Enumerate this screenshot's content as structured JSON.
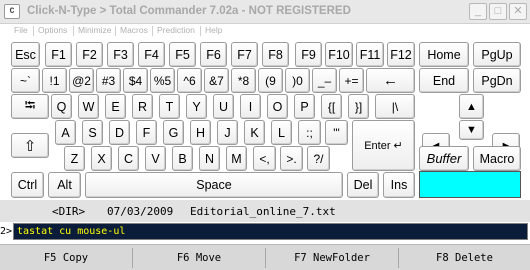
{
  "window": {
    "title": "Click-N-Type > Total Commander 7.02a - NOT REGISTERED",
    "icon_text": "C",
    "minimize_glyph": "_",
    "maximize_glyph": "□",
    "close_glyph": "✕"
  },
  "menu": [
    "File",
    "Options",
    "Minimize",
    "Macros",
    "Prediction",
    "Help"
  ],
  "keyboard": {
    "keys": {
      "esc": "Esc",
      "f1": "F1",
      "f2": "F2",
      "f3": "F3",
      "f4": "F4",
      "f5": "F5",
      "f6": "F6",
      "f7": "F7",
      "f8": "F8",
      "f9": "F9",
      "f10": "F10",
      "f11": "F11",
      "f12": "F12",
      "home": "Home",
      "pgup": "PgUp",
      "tilde": "~`",
      "k1": "!1",
      "k2": "@2",
      "k3": "#3",
      "k4": "$4",
      "k5": "%5",
      "k6": "^6",
      "k7": "&7",
      "k8": "*8",
      "k9": "(9",
      "k0": ")0",
      "minus": "_–",
      "plus": "+=",
      "backspace": "←",
      "end": "End",
      "pgdn": "PgDn",
      "tab": "⭾",
      "q": "Q",
      "w": "W",
      "e": "E",
      "r": "R",
      "t": "T",
      "y": "Y",
      "u": "U",
      "i": "I",
      "o": "O",
      "p": "P",
      "lbracket": "{[",
      "rbracket": "}]",
      "backslash": "|\\",
      "up": "▲",
      "a": "A",
      "s": "S",
      "d": "D",
      "f": "F",
      "g": "G",
      "h": "H",
      "j": "J",
      "k": "K",
      "l": "L",
      "semicolon": ":;",
      "quote": "\"'",
      "enter": "Enter ↵",
      "left": "◄",
      "right": "►",
      "shift": "⇧",
      "z": "Z",
      "x": "X",
      "c": "C",
      "v": "V",
      "b": "B",
      "n": "N",
      "m": "M",
      "comma": "<,",
      "period": ">.",
      "slash": "?/",
      "buffer": "Buffer",
      "macro": "Macro",
      "down": "▼",
      "ctrl": "Ctrl",
      "alt": "Alt",
      "space": "Space",
      "del": "Del",
      "ins": "Ins"
    },
    "prediction_box_color": "#00ffff"
  },
  "file_row": {
    "type": "<DIR>",
    "date": "07/03/2009",
    "name": "Editorial_online_7.txt"
  },
  "command": {
    "prompt": "2>",
    "value": "tastat cu mouse-ul"
  },
  "function_keys": [
    "F5 Copy",
    "F6 Move",
    "F7 NewFolder",
    "F8 Delete"
  ]
}
